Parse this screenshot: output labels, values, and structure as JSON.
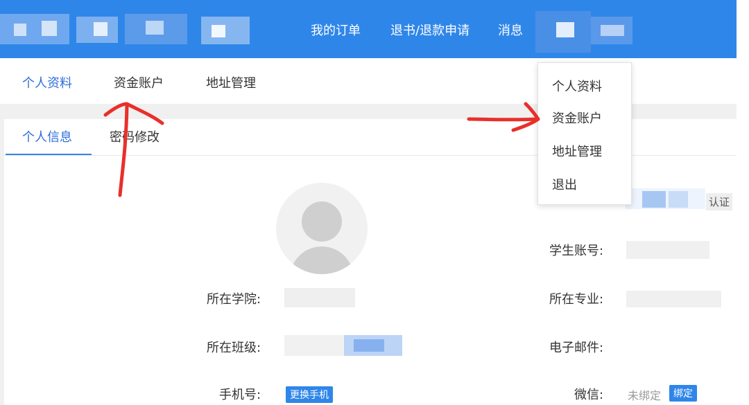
{
  "header": {
    "nav": [
      "我的订单",
      "退书/退款申请",
      "消息"
    ],
    "bg_color": "#2f86e9"
  },
  "tabs_primary": [
    "个人资料",
    "资金账户",
    "地址管理"
  ],
  "tabs_secondary": [
    "个人信息",
    "密码修改"
  ],
  "user_menu": [
    "个人资料",
    "资金账户",
    "地址管理",
    "退出"
  ],
  "profile": {
    "avatar_icon": "default-avatar-icon",
    "verify_badge": "认证",
    "fields": {
      "student_account": "学生账号:",
      "college": "所在学院:",
      "major": "所在专业:",
      "class": "所在班级:",
      "email": "电子邮件:",
      "phone": "手机号:",
      "change_phone_button": "更换手机",
      "wechat": "微信:",
      "wechat_status": "未绑定",
      "bind_button": "绑定"
    }
  },
  "annotations": {
    "arrow_color": "#e8302a"
  },
  "accent_color": "#2f6fdc"
}
